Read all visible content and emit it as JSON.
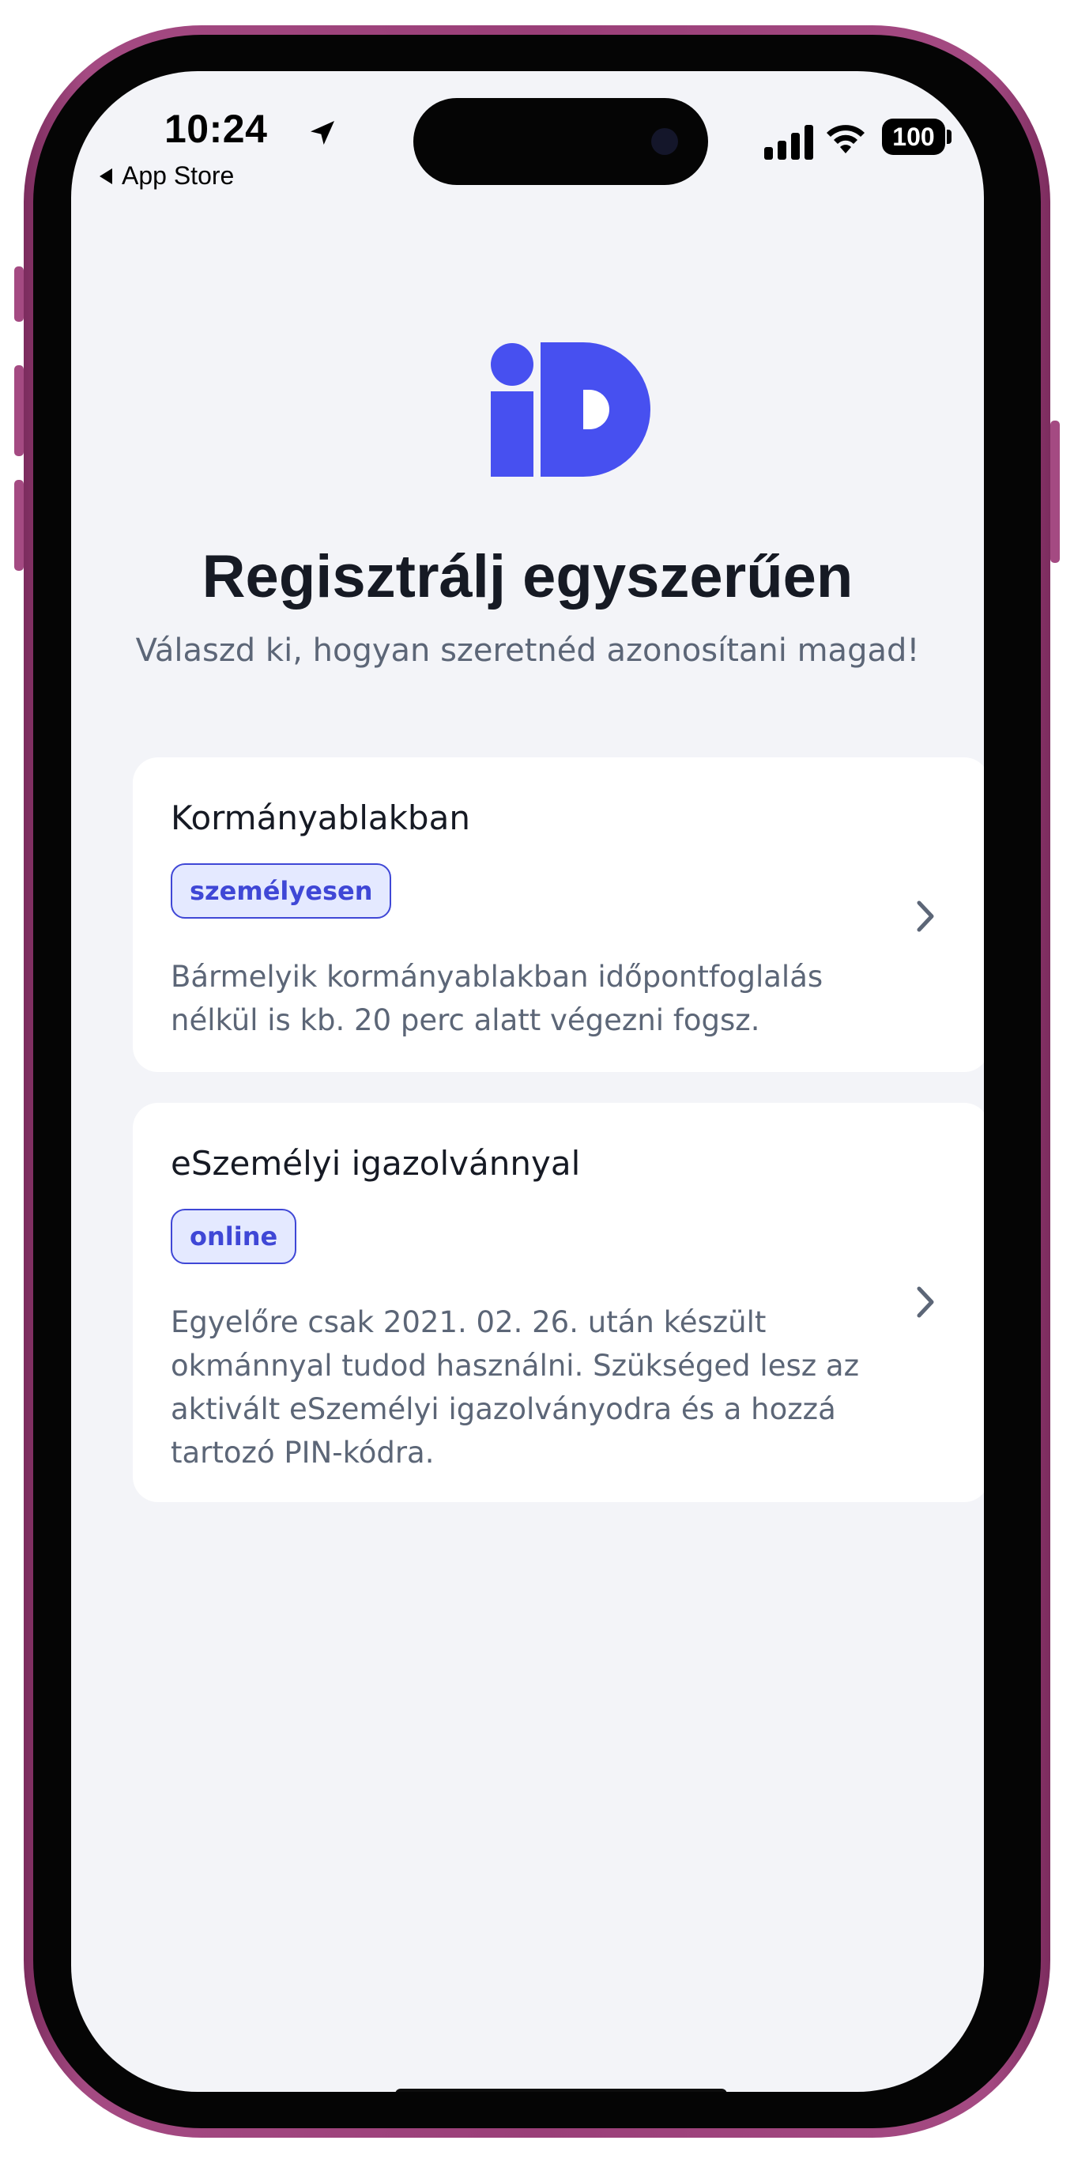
{
  "status_bar": {
    "time": "10:24",
    "back_app_label": "App Store",
    "battery_level": "100",
    "icons": [
      "location-arrow-icon",
      "cellular-signal-icon",
      "wifi-icon",
      "battery-icon"
    ]
  },
  "logo": {
    "icon": "id-logo",
    "accent_color": "#4750f0"
  },
  "header": {
    "title": "Regisztrálj egyszerűen",
    "subtitle": "Válaszd ki, hogyan szeretnéd azonosítani magad!"
  },
  "options": [
    {
      "title": "Kormányablakban",
      "badge": "személyesen",
      "description": "Bármelyik kormányablakban időpontfoglalás nélkül is kb. 20 perc alatt végezni fogsz.",
      "icon": "chevron-right-icon"
    },
    {
      "title": "eSzemélyi igazolvánnyal",
      "badge": "online",
      "description": "Egyelőre csak 2021. 02. 26. után készült okmánnyal tudod használni. Szükséged lesz az aktivált eSzemélyi igazolványodra és a hozzá tartozó PIN-kódra.",
      "icon": "chevron-right-icon"
    }
  ],
  "colors": {
    "brand": "#4750f0",
    "badge_text": "#3f47d6",
    "badge_bg": "#e4e9ff",
    "background": "#f3f4f8",
    "title_text": "#161a24",
    "muted_text": "#5c6677"
  }
}
